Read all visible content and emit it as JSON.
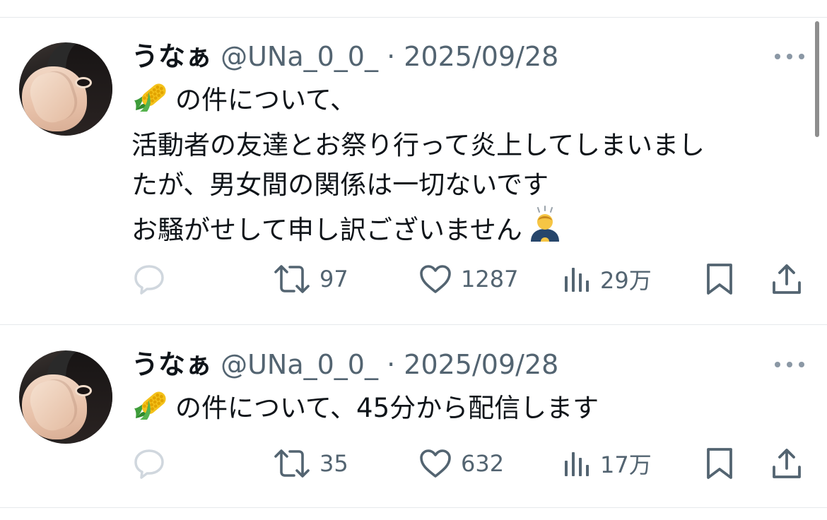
{
  "tweets": [
    {
      "author": {
        "name": "うなぁ",
        "handle": "@UNa_0_0_",
        "separator": "·",
        "date": "2025/09/28"
      },
      "emoji_lead": "corn-emoji",
      "lines": [
        "の件について、",
        "活動者の友達とお祭り行って炎上してしまいまし",
        "たが、男女間の関係は一切ないです",
        "お騒がせして申し訳ございません"
      ],
      "emoji_trail": "bowing-person-emoji",
      "stats": {
        "retweets": "97",
        "likes": "1287",
        "views": "29万"
      }
    },
    {
      "author": {
        "name": "うなぁ",
        "handle": "@UNa_0_0_",
        "separator": "·",
        "date": "2025/09/28"
      },
      "emoji_lead": "corn-emoji",
      "lines": [
        "の件について、45分から配信します"
      ],
      "stats": {
        "retweets": "35",
        "likes": "632",
        "views": "17万"
      }
    }
  ],
  "colors": {
    "text_primary": "#0f1419",
    "text_secondary": "#536471",
    "divider": "#e6e9ec",
    "reply_icon_muted": "#d0d7de"
  }
}
